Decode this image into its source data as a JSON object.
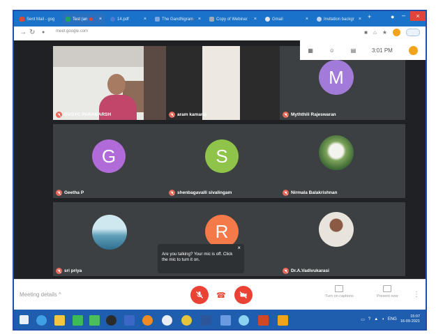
{
  "browser": {
    "tabs": [
      {
        "title": "Sent Mail - gog",
        "color": "#d64c3b",
        "active": false
      },
      {
        "title": "Test (an",
        "color": "#1fa463",
        "active": true
      },
      {
        "title": "14.pdf",
        "color": "#4c7bd6",
        "active": false
      },
      {
        "title": "The Gandhigram",
        "color": "#7aa7df",
        "active": false
      },
      {
        "title": "Copy of Webinar",
        "color": "#9fa9b5",
        "active": false
      },
      {
        "title": "Gmail",
        "color": "#e0e6ef",
        "active": false
      },
      {
        "title": "Invitation backgr",
        "color": "#bcd3ef",
        "active": false
      }
    ],
    "new_tab": "+",
    "url": "meet.google.com"
  },
  "meeting": {
    "top_overlay": {
      "time": "3:01 PM"
    },
    "participants": [
      {
        "name": "GVGYC PARAMARSH",
        "kind": "video"
      },
      {
        "name": "aram kamaraj",
        "kind": "video"
      },
      {
        "name": "Myththili Rajeswaran",
        "kind": "avatar",
        "initial": "M",
        "color": "#a27bd8"
      },
      {
        "name": "Geetha P",
        "kind": "avatar",
        "initial": "G",
        "color": "#b16bd9"
      },
      {
        "name": "shenbagavalli sivalingam",
        "kind": "avatar",
        "initial": "S",
        "color": "#8fc34a"
      },
      {
        "name": "Nirmala Balakrishnan",
        "kind": "photo"
      },
      {
        "name": "sri priya",
        "kind": "photo"
      },
      {
        "name": "Dr.A.Vadivukarasi",
        "kind": "photo"
      }
    ],
    "partial_initial": "R",
    "partial_color": "#f47a4a",
    "popup": {
      "text": "Are you talking? Your mic is off. Click the mic to turn it on.",
      "close": "×"
    }
  },
  "controls": {
    "meeting_details": "Meeting details",
    "turn_on_captions": "Turn on captions",
    "present_now": "Present now"
  },
  "taskbar": {
    "lang": "ENG",
    "time": "15:07",
    "date": "16-09-2021"
  }
}
